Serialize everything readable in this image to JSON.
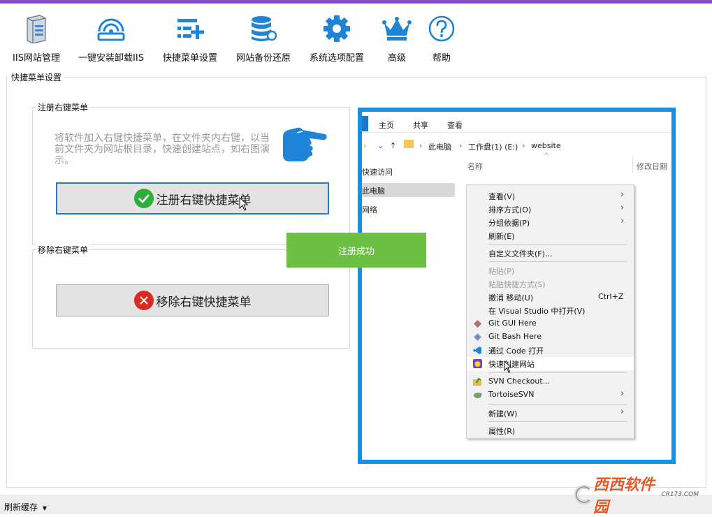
{
  "toolbar": {
    "items": [
      {
        "label": "IIS网站管理",
        "icon": "server-icon"
      },
      {
        "label": "一键安装卸载IIS",
        "icon": "disk-icon"
      },
      {
        "label": "快捷菜单设置",
        "icon": "menu-add-icon"
      },
      {
        "label": "网站备份还原",
        "icon": "database-icon"
      },
      {
        "label": "系统选项配置",
        "icon": "gear-icon"
      },
      {
        "label": "高级",
        "icon": "crown-icon"
      },
      {
        "label": "帮助",
        "icon": "help-icon"
      }
    ]
  },
  "settings": {
    "group_title": "快捷菜单设置",
    "register": {
      "group_title": "注册右键菜单",
      "hint": "将软件加入右键快捷菜单，在文件夹内右键，以当前文件夹为网站根目录，快速创建站点，如右图演示。",
      "button": "注册右键快捷菜单"
    },
    "remove": {
      "group_title": "移除右键菜单",
      "button": "移除右键快捷菜单"
    },
    "toast": "注册成功"
  },
  "explorer": {
    "tabs": [
      "主页",
      "共享",
      "查看"
    ],
    "breadcrumb": [
      "此电脑",
      "工作盘(1) (E:)",
      "website"
    ],
    "nav": [
      "快速访问",
      "此电脑",
      "网络"
    ],
    "columns": [
      "名称",
      "修改日期"
    ]
  },
  "context_menu": {
    "items": [
      {
        "label": "查看(V)",
        "submenu": true
      },
      {
        "label": "排序方式(O)",
        "submenu": true
      },
      {
        "label": "分组依据(P)",
        "submenu": true
      },
      {
        "label": "刷新(E)"
      },
      {
        "label": "自定义文件夹(F)..."
      },
      {
        "label": "粘贴(P)",
        "disabled": true
      },
      {
        "label": "粘贴快捷方式(S)",
        "disabled": true
      },
      {
        "label": "撤消 移动(U)",
        "shortcut": "Ctrl+Z"
      },
      {
        "label": "在 Visual Studio 中打开(V)"
      },
      {
        "label": "Git GUI Here"
      },
      {
        "label": "Git Bash Here"
      },
      {
        "label": "通过 Code 打开"
      },
      {
        "label": "快速创建网站"
      },
      {
        "label": "SVN Checkout..."
      },
      {
        "label": "TortoiseSVN",
        "submenu": true
      },
      {
        "label": "新建(W)",
        "submenu": true
      },
      {
        "label": "属性(R)"
      }
    ]
  },
  "statusbar": {
    "dropdown_label": "刷新缓存"
  },
  "watermark": {
    "text": "西西软件园",
    "sub": "CR173.COM"
  },
  "colors": {
    "accent_purple": "#7e4fc9",
    "toolbar_blue": "#1d84d8",
    "success_green": "#6cc043",
    "error_red": "#d92b21",
    "preview_border": "#1a8fe0"
  }
}
